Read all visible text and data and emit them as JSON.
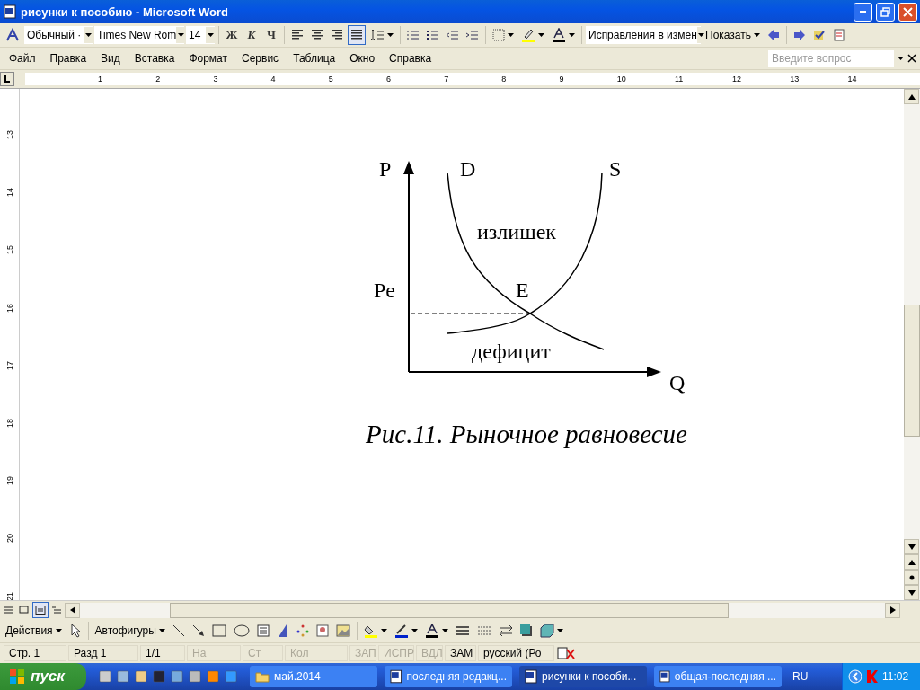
{
  "window": {
    "title": "рисунки к пособию - Microsoft Word"
  },
  "formatting_toolbar": {
    "style": "Обычный ·",
    "font": "Times New Rom",
    "size": "14",
    "bold": "Ж",
    "italic": "К",
    "underline": "Ч",
    "review_mode": "Исправления в измен",
    "show_menu": "Показать"
  },
  "alignment": [
    {
      "kind": "left",
      "selected": false
    },
    {
      "kind": "center",
      "selected": false
    },
    {
      "kind": "right",
      "selected": false
    },
    {
      "kind": "justify",
      "selected": true
    }
  ],
  "menu": [
    "Файл",
    "Правка",
    "Вид",
    "Вставка",
    "Формат",
    "Сервис",
    "Таблица",
    "Окно",
    "Справка"
  ],
  "help_search": {
    "placeholder": "Введите вопрос"
  },
  "ruler": {
    "horizontal": [
      "1",
      "2",
      "3",
      "4",
      "5",
      "6",
      "7",
      "8",
      "9",
      "10",
      "11",
      "12",
      "13",
      "14"
    ],
    "vertical": [
      "13",
      "14",
      "15",
      "16",
      "17",
      "18",
      "19",
      "20",
      "21"
    ]
  },
  "figure": {
    "p_axis": "P",
    "q_axis": "Q",
    "demand": "D",
    "supply": "S",
    "price": "Pe",
    "equilibrium": "E",
    "surplus": "излишек",
    "deficit": "дефицит",
    "caption": "Рис.11. Рыночное равновесие"
  },
  "view_buttons": [
    {
      "kind": "normal",
      "selected": false
    },
    {
      "kind": "web",
      "selected": false
    },
    {
      "kind": "print",
      "selected": true
    },
    {
      "kind": "outline",
      "selected": false
    }
  ],
  "drawing_toolbar": {
    "actions": "Действия",
    "autoshapes": "Автофигуры"
  },
  "status_bar": [
    {
      "text": "Стр. 1",
      "disabled": false
    },
    {
      "text": "Разд 1",
      "disabled": false
    },
    {
      "text": "1/1",
      "disabled": false
    },
    {
      "text": "На",
      "disabled": true
    },
    {
      "text": "Ст",
      "disabled": true
    },
    {
      "text": "Кол",
      "disabled": true
    },
    {
      "text": "ЗАП",
      "disabled": true
    },
    {
      "text": "ИСПР",
      "disabled": true
    },
    {
      "text": "ВДЛ",
      "disabled": true
    },
    {
      "text": "ЗАМ",
      "disabled": false
    },
    {
      "text": "русский (Ро",
      "disabled": false
    }
  ],
  "taskbar": {
    "start": "пуск",
    "buttons": [
      {
        "label": "май.2014",
        "kind": "folder",
        "selected": false
      },
      {
        "label": "последняя редакц...",
        "kind": "word",
        "selected": false
      },
      {
        "label": "рисунки к пособи...",
        "kind": "word",
        "selected": true
      },
      {
        "label": "общая-последняя ...",
        "kind": "word",
        "selected": false
      }
    ],
    "language": "RU",
    "clock": "11:02"
  }
}
